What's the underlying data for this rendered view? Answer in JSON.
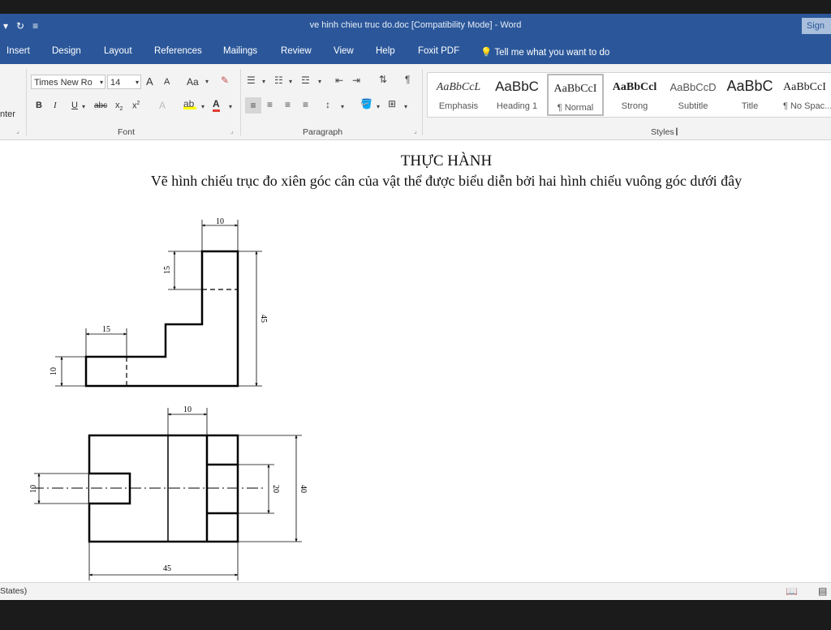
{
  "window": {
    "title": "ve hinh chieu truc do.doc [Compatibility Mode]  -  Word",
    "sign_in": "Sign",
    "qat_icons": [
      "undo-dropdown-icon",
      "redo-icon",
      "customize-qat-icon"
    ]
  },
  "tabs": [
    "Insert",
    "Design",
    "Layout",
    "References",
    "Mailings",
    "Review",
    "View",
    "Help",
    "Foxit PDF"
  ],
  "tell_me": "Tell me what you want to do",
  "ribbon": {
    "clipboard_partial": "nter",
    "font": {
      "family": "Times New Ro",
      "size": "14",
      "grow": "A",
      "shrink": "A",
      "change_case": "Aa",
      "bold": "B",
      "italic": "I",
      "underline": "U",
      "strikethrough": "abc",
      "subscript": "x",
      "superscript": "x",
      "label": "Font"
    },
    "paragraph_label": "Paragraph",
    "styles_label": "Styles",
    "styles": [
      {
        "sample": "AaBbCcL",
        "name": "Emphasis"
      },
      {
        "sample": "AaBbC",
        "name": "Heading 1"
      },
      {
        "sample": "AaBbCcI",
        "name": "¶ Normal"
      },
      {
        "sample": "AaBbCcl",
        "name": "Strong"
      },
      {
        "sample": "AaBbCcD",
        "name": "Subtitle"
      },
      {
        "sample": "AaBbC",
        "name": "Title"
      },
      {
        "sample": "AaBbCcI",
        "name": "¶ No Spac..."
      }
    ]
  },
  "document": {
    "heading": "THỰC HÀNH",
    "subheading": "Vẽ hình chiếu trục đo xiên góc cân của vật thể được biểu diễn bởi hai hình chiếu vuông góc dưới đây",
    "front_view_dims": {
      "top": "10",
      "upper_left": "15",
      "step": "15",
      "base": "10",
      "height": "45"
    },
    "top_view_dims": {
      "top": "10",
      "left": "10",
      "right_inner": "20",
      "right": "40",
      "bottom": "45"
    }
  },
  "status": {
    "text": "States)"
  },
  "colors": {
    "accent": "#2b579a",
    "ribbon": "#f3f3f3"
  }
}
